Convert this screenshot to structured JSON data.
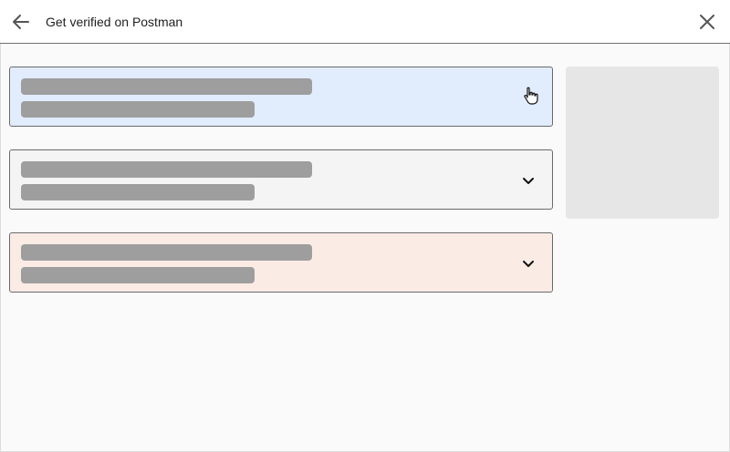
{
  "header": {
    "title": "Get verified on Postman",
    "back_icon": "arrow-left-icon",
    "close_icon": "close-icon"
  },
  "cards": [
    {
      "color": "#e1ecfd",
      "state": "hovered",
      "icon": "pointer-hand-icon"
    },
    {
      "color": "#f4f4f4",
      "state": "collapsed",
      "icon": "chevron-down-icon"
    },
    {
      "color": "#fbebe5",
      "state": "collapsed",
      "icon": "chevron-down-icon"
    }
  ],
  "colors": {
    "skeleton": "#9e9e9e",
    "side_panel": "#e6e6e6",
    "border": "#6a6a6a"
  }
}
